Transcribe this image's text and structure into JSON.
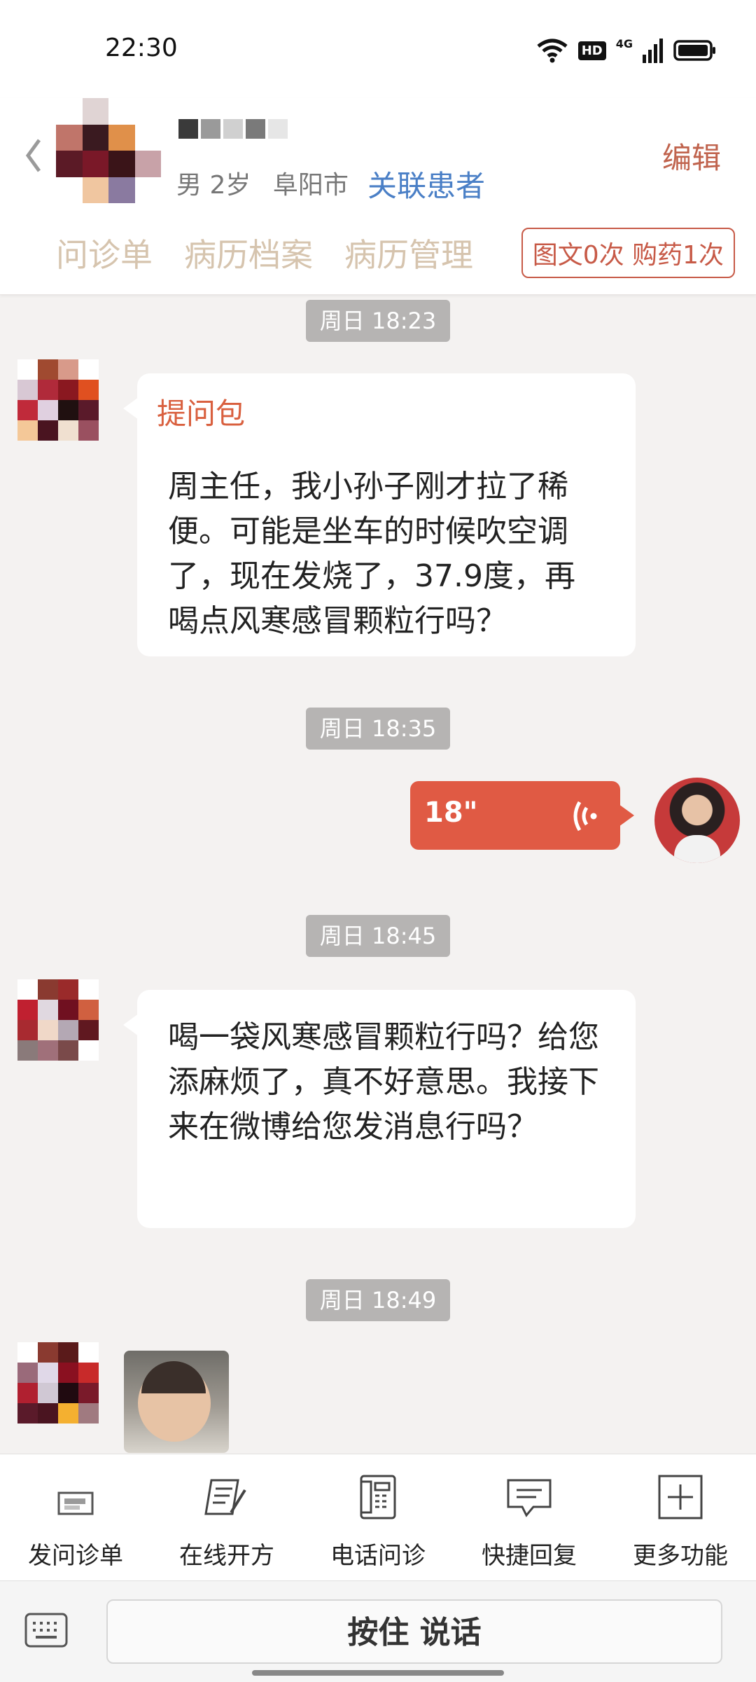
{
  "status_bar": {
    "time": "22:30",
    "hd_label": "HD",
    "network_label": "4G"
  },
  "header": {
    "patient_gender_age": "男 2岁",
    "patient_city": "阜阳市",
    "link_patient_label": "关联患者",
    "edit_label": "编辑",
    "tabs": [
      "问诊单",
      "病历档案",
      "病历管理"
    ],
    "service_pill": "图文0次 购药1次"
  },
  "messages": [
    {
      "timestamp": "周日 18:23",
      "sender": "patient",
      "title": "提问包",
      "text": "周主任，我小孙子刚才拉了稀便。可能是坐车的时候吹空调了，现在发烧了，37.9度，再喝点风寒感冒颗粒行吗？"
    },
    {
      "timestamp": "周日 18:35",
      "sender": "doctor",
      "voice_duration": "18\""
    },
    {
      "timestamp": "周日 18:45",
      "sender": "patient",
      "text": "喝一袋风寒感冒颗粒行吗？给您添麻烦了，真不好意思。我接下来在微博给您发消息行吗？"
    },
    {
      "timestamp": "周日 18:49",
      "sender": "patient",
      "type": "image"
    }
  ],
  "toolbar": {
    "items": [
      {
        "label": "发问诊单",
        "icon": "form-icon"
      },
      {
        "label": "在线开方",
        "icon": "prescription-icon"
      },
      {
        "label": "电话问诊",
        "icon": "phone-icon"
      },
      {
        "label": "快捷回复",
        "icon": "quick-reply-icon"
      },
      {
        "label": "更多功能",
        "icon": "plus-icon"
      }
    ]
  },
  "input_bar": {
    "hold_to_talk_label": "按住 说话"
  },
  "colors": {
    "accent": "#e05a44",
    "link": "#4a7fc6",
    "timestamp_bg": "#b6b4b3"
  }
}
